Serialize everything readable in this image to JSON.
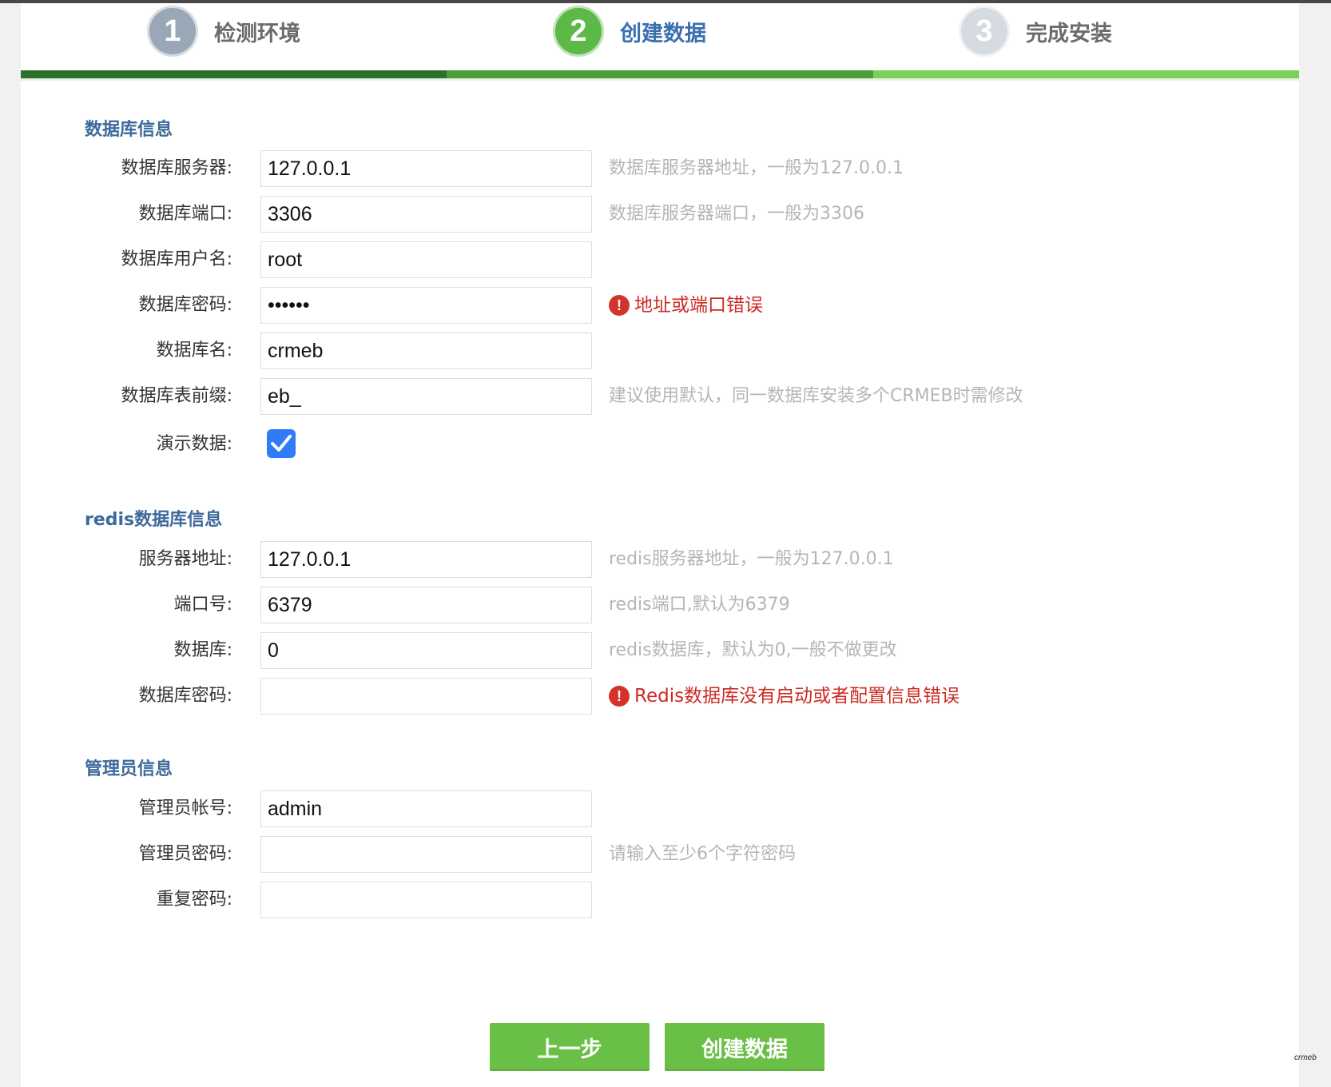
{
  "steps": [
    {
      "number": "1",
      "label": "检测环境",
      "circle_color": "#9aa7b7",
      "label_color": "#6b6b6b"
    },
    {
      "number": "2",
      "label": "创建数据",
      "circle_color": "#5cb847",
      "label_color": "#3a6fb0"
    },
    {
      "number": "3",
      "label": "完成安装",
      "circle_color": "#d6dbe2",
      "label_color": "#6b6b6b"
    }
  ],
  "progress_colors": [
    "#2e6f2b",
    "#4a9e3a",
    "#7bcf5a"
  ],
  "db_section": {
    "title": "数据库信息",
    "fields": [
      {
        "label": "数据库服务器:",
        "value": "127.0.0.1",
        "hint": "数据库服务器地址，一般为127.0.0.1"
      },
      {
        "label": "数据库端口:",
        "value": "3306",
        "hint": "数据库服务器端口，一般为3306"
      },
      {
        "label": "数据库用户名:",
        "value": "root",
        "hint": ""
      },
      {
        "label": "数据库密码:",
        "value": "••••••",
        "error": "地址或端口错误"
      },
      {
        "label": "数据库名:",
        "value": "crmeb",
        "hint": ""
      },
      {
        "label": "数据库表前缀:",
        "value": "eb_",
        "hint": "建议使用默认，同一数据库安装多个CRMEB时需修改"
      }
    ],
    "demo_label": "演示数据:",
    "demo_checked": true
  },
  "redis_section": {
    "title": "redis数据库信息",
    "fields": [
      {
        "label": "服务器地址:",
        "value": "127.0.0.1",
        "hint": "redis服务器地址，一般为127.0.0.1"
      },
      {
        "label": "端口号:",
        "value": "6379",
        "hint": "redis端口,默认为6379"
      },
      {
        "label": "数据库:",
        "value": "0",
        "hint": "redis数据库，默认为0,一般不做更改"
      },
      {
        "label": "数据库密码:",
        "value": "",
        "error": "Redis数据库没有启动或者配置信息错误"
      }
    ]
  },
  "admin_section": {
    "title": "管理员信息",
    "fields": [
      {
        "label": "管理员帐号:",
        "value": "admin",
        "hint": ""
      },
      {
        "label": "管理员密码:",
        "value": "",
        "hint": "请输入至少6个字符密码"
      },
      {
        "label": "重复密码:",
        "value": "",
        "hint": ""
      }
    ]
  },
  "buttons": {
    "prev": "上一步",
    "create": "创建数据"
  },
  "error_icon": "!",
  "watermark": "crmeb"
}
